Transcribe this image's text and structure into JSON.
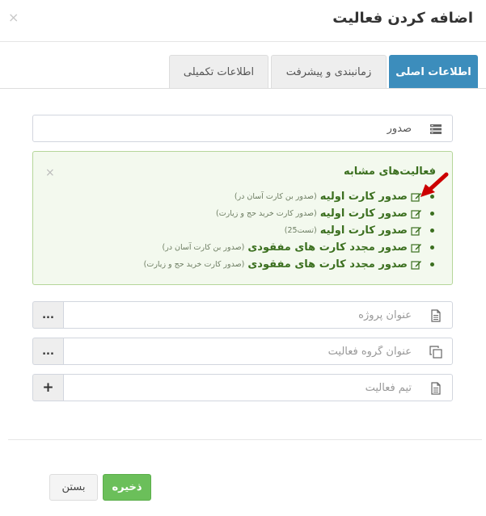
{
  "modal": {
    "title": "اضافه کردن فعالیت",
    "close_symbol": "×"
  },
  "tabs": [
    {
      "label": "اطلاعات اصلی",
      "active": true
    },
    {
      "label": "زمانبندی و پیشرفت",
      "active": false
    },
    {
      "label": "اطلاعات تکمیلی",
      "active": false
    }
  ],
  "activity_field": {
    "value": "صدور",
    "icon": "list-icon"
  },
  "similar": {
    "title": "فعالیت‌های مشابه",
    "close_symbol": "×",
    "items": [
      {
        "name": "صدور کارت اولیه",
        "detail": "(صدور بن کارت آسان در)"
      },
      {
        "name": "صدور کارت اولیه",
        "detail": "(صدور کارت خرید حج و زیارت)"
      },
      {
        "name": "صدور کارت اولیه",
        "detail": "(تست25)"
      },
      {
        "name": "صدور مجدد کارت های مفقودی",
        "detail": "(صدور بن کارت آسان در)"
      },
      {
        "name": "صدور مجدد کارت های مفقودی",
        "detail": "(صدور کارت خرید حج و زیارت)"
      }
    ]
  },
  "project_field": {
    "placeholder": "عنوان پروژه",
    "addon": "..."
  },
  "group_field": {
    "placeholder": "عنوان گروه فعالیت",
    "addon": "..."
  },
  "team_field": {
    "placeholder": "تیم فعالیت",
    "addon": "+"
  },
  "footer": {
    "save_label": "ذخیره",
    "close_label": "بستن"
  },
  "colors": {
    "primary": "#3c8dbc",
    "success": "#6bbf5a",
    "alert_bg": "#f3f9ee",
    "alert_text": "#3b6f1f",
    "arrow": "#cc0000"
  }
}
